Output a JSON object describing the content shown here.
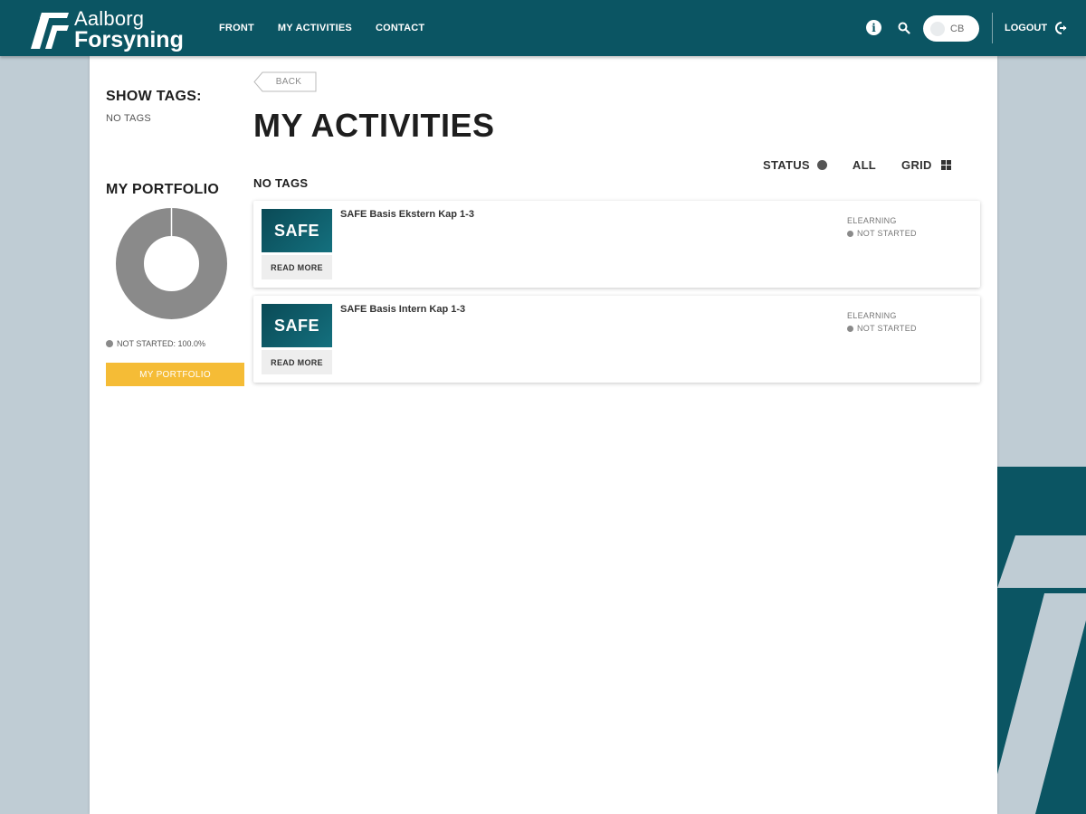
{
  "header": {
    "brand_line1": "Aalborg",
    "brand_line2": "Forsyning",
    "nav": [
      {
        "label": "FRONT"
      },
      {
        "label": "MY ACTIVITIES"
      },
      {
        "label": "CONTACT"
      }
    ],
    "info_glyph": "i",
    "user_initials": "CB",
    "logout_label": "LOGOUT",
    "icons": [
      "logo-mark-icon",
      "info-icon",
      "search-icon",
      "logout-icon"
    ]
  },
  "sidebar": {
    "show_tags_title": "SHOW TAGS:",
    "no_tags": "NO TAGS",
    "portfolio_title": "MY PORTFOLIO",
    "legend": "NOT STARTED: 100.0%",
    "portfolio_button": "MY PORTFOLIO",
    "donut": {
      "segments": [
        {
          "label": "NOT STARTED",
          "percent": 100.0,
          "color": "#8a8a8a"
        }
      ]
    }
  },
  "main": {
    "back_label": "BACK",
    "page_title": "MY ACTIVITIES",
    "filters": {
      "status": "STATUS",
      "all": "ALL",
      "grid": "GRID"
    },
    "no_tags": "NO TAGS",
    "activities": [
      {
        "thumb_text": "SAFE",
        "read_more": "READ MORE",
        "title": "SAFE Basis Ekstern Kap 1-3",
        "type": "ELEARNING",
        "status": "NOT STARTED"
      },
      {
        "thumb_text": "SAFE",
        "read_more": "READ MORE",
        "title": "SAFE Basis Intern Kap 1-3",
        "type": "ELEARNING",
        "status": "NOT STARTED"
      }
    ]
  },
  "colors": {
    "header_bg": "#0b5563",
    "page_bg": "#bfccd4",
    "accent_yellow": "#f5bc36",
    "status_grey": "#8a8a8a"
  }
}
